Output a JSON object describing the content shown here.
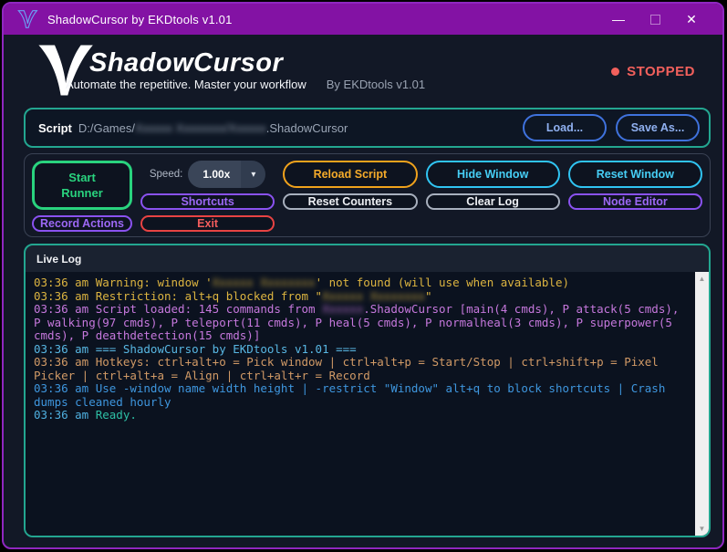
{
  "window": {
    "title": "ShadowCursor by EKDtools v1.01",
    "controls": {
      "minimize": "—",
      "close": "✕"
    }
  },
  "header": {
    "brand": "ShadowCursor",
    "tagline": "Automate the repetitive. Master your workflow",
    "byline": "By EKDtools v1.01",
    "status": {
      "label": "STOPPED",
      "color": "#f2605c"
    }
  },
  "script_bar": {
    "label": "Script",
    "path_prefix": "D:/Games/",
    "path_redacted": "Xxxxxx Xxxxxxxx/Xxxxxx",
    "path_suffix": ".ShadowCursor",
    "load_label": "Load...",
    "save_as_label": "Save As..."
  },
  "toolbar": {
    "start_runner_line1": "Start",
    "start_runner_line2": "Runner",
    "speed_label": "Speed:",
    "speed_value": "1.00x",
    "chevron": "▾",
    "reset_counters": "Reset Counters",
    "reload_script": "Reload Script",
    "clear_log": "Clear Log",
    "hide_window": "Hide Window",
    "node_editor": "Node Editor",
    "reset_window": "Reset Window",
    "record_actions": "Record Actions",
    "shortcuts": "Shortcuts",
    "exit": "Exit"
  },
  "log": {
    "title": "Live Log",
    "scroll_up": "▲",
    "scroll_down": "▼",
    "lines": [
      {
        "color": "#dcb440",
        "segments": [
          {
            "text": "03:36 am Warning: window '"
          },
          {
            "text": "Xxxxxx Xxxxxxxx",
            "redacted": true
          },
          {
            "text": "' not found (will use when available)"
          }
        ]
      },
      {
        "color": "#dcb440",
        "segments": [
          {
            "text": "03:36 am Restriction: alt+q blocked from \""
          },
          {
            "text": "Xxxxxx Xxxxxxxx",
            "redacted": true
          },
          {
            "text": "\""
          }
        ]
      },
      {
        "color": "#c678dd",
        "segments": [
          {
            "text": "03:36 am Script loaded: 145 commands from "
          },
          {
            "text": "Xxxxxx",
            "redacted": true
          },
          {
            "text": ".ShadowCursor [main(4 cmds), P attack(5 cmds), P walking(97 cmds), P teleport(11 cmds), P heal(5 cmds), P normalheal(3 cmds), P superpower(5 cmds), P deathdetection(15 cmds)]"
          }
        ]
      },
      {
        "color": "#58b7e3",
        "segments": [
          {
            "text": "03:36 am === ShadowCursor by EKDtools v1.01 ==="
          }
        ]
      },
      {
        "color": "#d19a66",
        "segments": [
          {
            "text": "03:36 am Hotkeys: ctrl+alt+o = Pick window | ctrl+alt+p = Start/Stop | ctrl+shift+p = Pixel Picker | ctrl+alt+a = Align | ctrl+alt+r = Record"
          }
        ]
      },
      {
        "color": "#3e96de",
        "segments": [
          {
            "text": "03:36 am Use -window name width height | -restrict \"Window\" alt+q to block shortcuts | Crash dumps cleaned hourly"
          }
        ]
      },
      {
        "color": "#4fb0e0",
        "segments": [
          {
            "text": "03:36 am "
          },
          {
            "text": "Ready.",
            "color": "#2ebfa5"
          }
        ]
      }
    ]
  }
}
